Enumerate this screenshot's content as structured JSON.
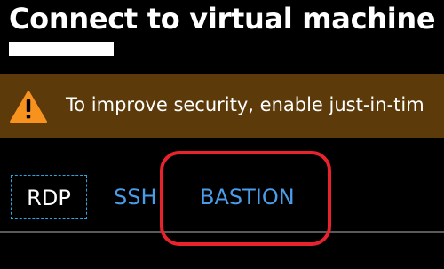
{
  "header": {
    "title": "Connect to virtual machine"
  },
  "banner": {
    "icon": "warning-icon",
    "message": "To improve security, enable just-in-tim"
  },
  "tabs": [
    {
      "label": "RDP",
      "selected": true
    },
    {
      "label": "SSH",
      "selected": false
    },
    {
      "label": "BASTION",
      "selected": false
    }
  ],
  "colors": {
    "background": "#000000",
    "banner_bg": "#5c3a0a",
    "warning_icon": "#f7921e",
    "tab_link": "#4a9de8",
    "focus_outline": "#2aa6e0",
    "annotation": "#e8232d"
  }
}
